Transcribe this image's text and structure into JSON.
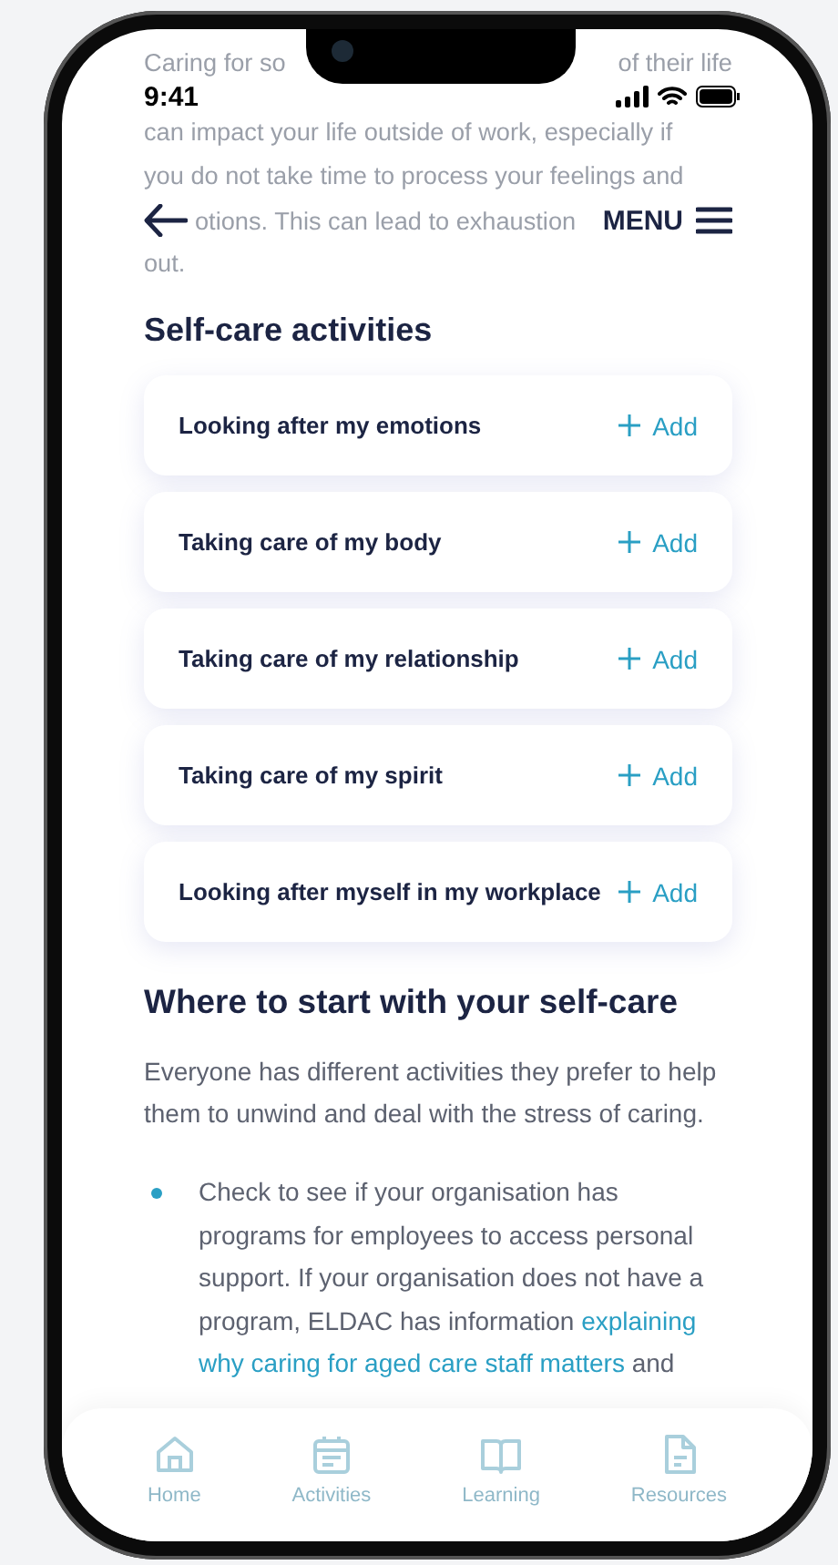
{
  "status_bar": {
    "time": "9:41"
  },
  "faded_intro": {
    "first_line_left": "Caring for so",
    "first_line_right": "of their life",
    "lines": [
      "can impact your life outside of work, especially if",
      "you do not take time to process your feelings and"
    ],
    "beside_header": "otions. This can lead to exhaustion",
    "last_line": "out."
  },
  "header": {
    "menu_label": "MENU"
  },
  "activities": {
    "title": "Self-care activities",
    "items": [
      {
        "label": "Looking after my emotions",
        "action": "Add"
      },
      {
        "label": "Taking care of my body",
        "action": "Add"
      },
      {
        "label": "Taking care of my relationship",
        "action": "Add"
      },
      {
        "label": "Taking care of my spirit",
        "action": "Add"
      },
      {
        "label": "Looking after myself in my workplace",
        "action": "Add"
      }
    ]
  },
  "where_to_start": {
    "title": "Where to start with your self-care",
    "paragraph": "Everyone has different activities they prefer to help them to unwind and deal with the stress of caring.",
    "bullets": [
      {
        "text": "Check to see if your organisation has programs for employees to access personal support. If your organisation does not have a program, ELDAC has information",
        "link_parts": [
          "explaining",
          "why caring for aged care staff matters"
        ],
        "text_after": "and"
      }
    ]
  },
  "bottom_nav": [
    {
      "label": "Home",
      "kind": "home"
    },
    {
      "label": "Activities",
      "kind": "calendar"
    },
    {
      "label": "Learning",
      "kind": "book"
    },
    {
      "label": "Resources",
      "kind": "document"
    }
  ]
}
